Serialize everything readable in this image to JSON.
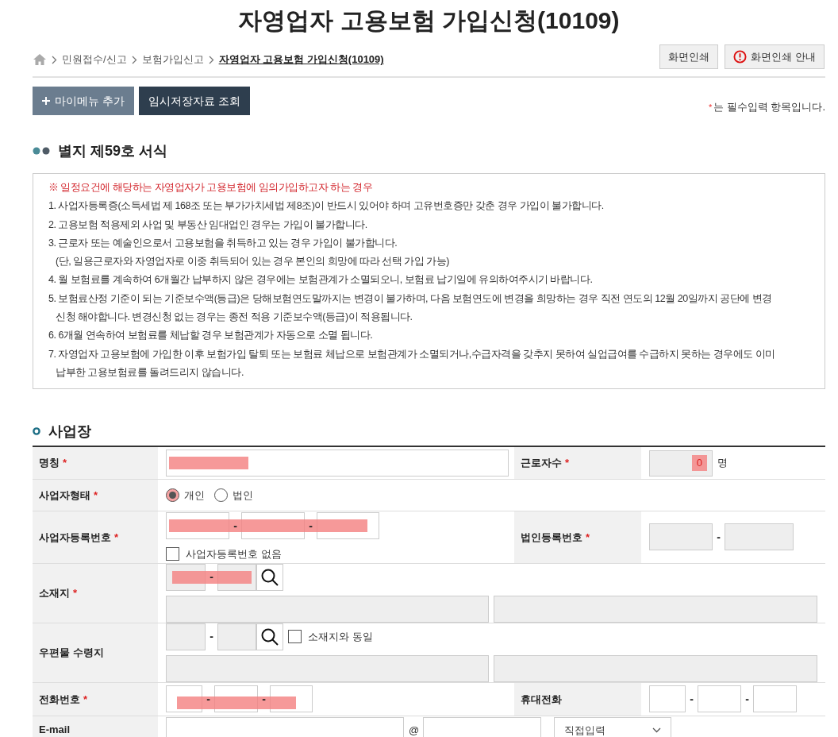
{
  "title": "자영업자 고용보험 가입신청(10109)",
  "breadcrumb": [
    {
      "label": "민원접수/신고",
      "current": false
    },
    {
      "label": "보험가입신고",
      "current": false
    },
    {
      "label": "자영업자 고용보험 가입신청(10109)",
      "current": true
    }
  ],
  "print_buttons": [
    {
      "label": "화면인쇄",
      "kind": "plain"
    },
    {
      "label": "화면인쇄 안내",
      "kind": "alert"
    }
  ],
  "toolbar": [
    {
      "label": "마이메뉴 추가",
      "kind": "add"
    },
    {
      "label": "임시저장자료 조회",
      "kind": "dark"
    }
  ],
  "required_mark": "*",
  "required_note": "는 필수입력 항목입니다.",
  "section_title": "별지 제59호 서식",
  "notice": {
    "heading": "※ 일정요건에 해당하는 자영업자가 고용보험에 임의가입하고자 하는 경우",
    "items": [
      {
        "lines": [
          "1. 사업자등록증(소득세법 제 168조 또는 부가가치세법 제8조)이 반드시 있어야 하며 고유번호증만 갖춘 경우 가입이 불가합니다."
        ]
      },
      {
        "lines": [
          "2. 고용보험 적용제외 사업 및 부동산 임대업인 경우는 가입이 불가합니다."
        ]
      },
      {
        "lines": [
          "3. 근로자 또는 예술인으로서 고용보험을 취득하고 있는 경우 가입이 불가합니다.",
          "(단, 일용근로자와 자영업자로 이중 취득되어 있는 경우 본인의 희망에 따라 선택 가입 가능)"
        ]
      },
      {
        "lines": [
          "4. 월 보험료를 계속하여 6개월간 납부하지 않은 경우에는 보험관계가 소멸되오니, 보험료 납기일에 유의하여주시기 바랍니다."
        ]
      },
      {
        "lines": [
          "5. 보험료산정 기준이 되는 기준보수액(등급)은 당해보험연도말까지는 변경이 불가하며, 다음 보험연도에 변경을 희망하는 경우 직전 연도의 12월 20일까지 공단에 변경",
          "신청 해야합니다. 변경신청 없는 경우는 종전 적용 기준보수액(등급)이 적용됩니다."
        ]
      },
      {
        "lines": [
          "6. 6개월 연속하여 보험료를 체납할 경우 보험관계가 자동으로 소멸 됩니다."
        ]
      },
      {
        "lines": [
          "7. 자영업자 고용보험에 가입한 이후 보험가입 탈퇴 또는 보험료 체납으로 보험관계가 소멸되거나,수급자격을 갖추지 못하여 실업급여를 수급하지 못하는 경우에도 이미",
          "납부한 고용보험료를 돌려드리지 않습니다."
        ]
      }
    ]
  },
  "workplace": {
    "title": "사업장",
    "rows": [
      {
        "kind": "name",
        "label": "명칭",
        "required": true,
        "redacted": true,
        "label2": "근로자수",
        "required2": true,
        "count": "0",
        "count_redacted": true,
        "unit": "명"
      },
      {
        "kind": "radio",
        "label": "사업자형태",
        "required": true,
        "options": [
          {
            "label": "개인",
            "selected": true
          },
          {
            "label": "법인",
            "selected": false
          }
        ]
      },
      {
        "kind": "bizno",
        "label": "사업자등록번호",
        "required": true,
        "separator": "-",
        "redacted": true,
        "checkbox": {
          "label": "사업자등록번호 없음",
          "checked": false
        },
        "label2": "법인등록번호",
        "required2": true,
        "separator2": "-"
      },
      {
        "kind": "address",
        "label": "소재지",
        "required": true,
        "separator": "-",
        "redacted": true
      },
      {
        "kind": "address",
        "label": "우편물 수령지",
        "required": false,
        "separator": "-",
        "redacted": false,
        "checkbox": {
          "label": "소재지와 동일",
          "checked": false
        }
      },
      {
        "kind": "phone",
        "label": "전화번호",
        "required": true,
        "separator": "-",
        "redacted": true,
        "label2": "휴대전화",
        "required2": false,
        "separator2": "-"
      },
      {
        "kind": "email",
        "label": "E-mail",
        "required": false,
        "at": "@",
        "select": "직접입력"
      }
    ]
  }
}
